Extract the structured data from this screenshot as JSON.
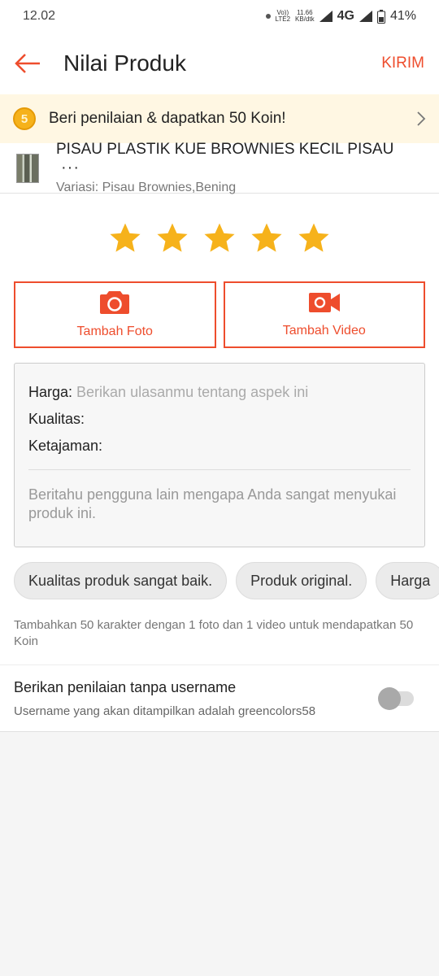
{
  "status_bar": {
    "time": "12.02",
    "volte": "Vo))",
    "lte": "LTE2",
    "speed_value": "11.66",
    "speed_unit": "KB/dtk",
    "network": "4G",
    "battery": "41%"
  },
  "app_bar": {
    "title": "Nilai Produk",
    "action": "KIRIM"
  },
  "banner": {
    "coin_symbol": "5",
    "text": "Beri penilaian & dapatkan 50 Koin!"
  },
  "product": {
    "name": "PISAU PLASTIK KUE BROWNIES KECIL PISAU",
    "more": "···",
    "variation": "Variasi: Pisau Brownies,Bening"
  },
  "rating": {
    "stars_filled": 5,
    "stars_total": 5,
    "star_color": "#f6b21b"
  },
  "media": {
    "photo_label": "Tambah Foto",
    "video_label": "Tambah Video"
  },
  "review": {
    "price_label": "Harga:",
    "price_placeholder": "Berikan ulasanmu tentang aspek ini",
    "quality_label": "Kualitas:",
    "sharpness_label": "Ketajaman:",
    "description_placeholder": "Beritahu pengguna lain mengapa Anda sangat menyukai produk ini."
  },
  "chips": [
    "Kualitas produk sangat baik.",
    "Produk original.",
    "Harga"
  ],
  "hint": "Tambahkan 50 karakter dengan 1 foto dan 1 video untuk mendapatkan 50 Koin",
  "anonymous": {
    "title": "Berikan penilaian tanpa username",
    "subtitle": "Username yang akan ditampilkan adalah greencolors58",
    "enabled": false
  },
  "colors": {
    "accent": "#ee4d2d",
    "banner_bg": "#fff7e3"
  }
}
